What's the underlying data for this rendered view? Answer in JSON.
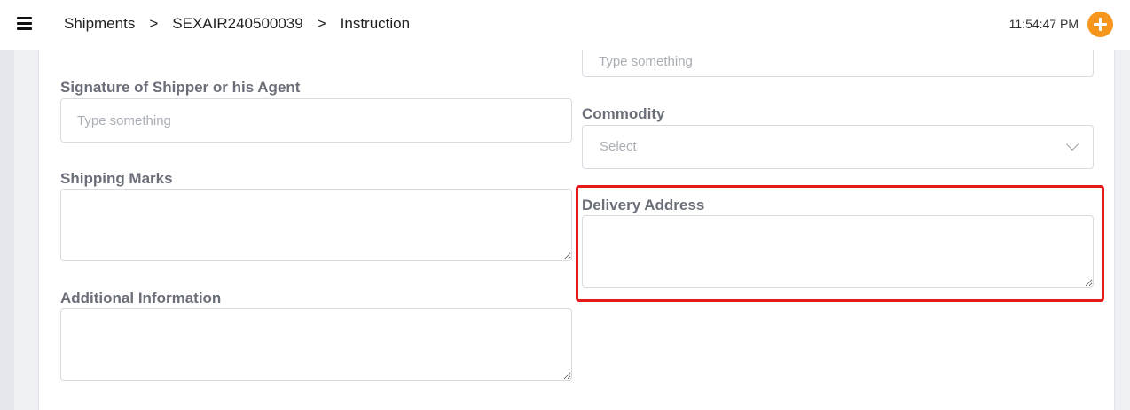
{
  "header": {
    "breadcrumb": {
      "shipments": "Shipments",
      "separator": ">",
      "shipment_id": "SEXAIR240500039",
      "current": "Instruction"
    },
    "time": "11:54:47 PM",
    "accent_color": "#f7961d"
  },
  "form": {
    "top_right_field": {
      "placeholder": "Type something",
      "value": ""
    },
    "signature": {
      "label": "Signature of Shipper or his Agent",
      "placeholder": "Type something",
      "value": ""
    },
    "commodity": {
      "label": "Commodity",
      "selected": "Select"
    },
    "shipping_marks": {
      "label": "Shipping Marks",
      "value": ""
    },
    "delivery_address": {
      "label": "Delivery Address",
      "value": "",
      "highlight_color": "#e41b1b"
    },
    "additional_information": {
      "label": "Additional Information",
      "value": ""
    }
  }
}
